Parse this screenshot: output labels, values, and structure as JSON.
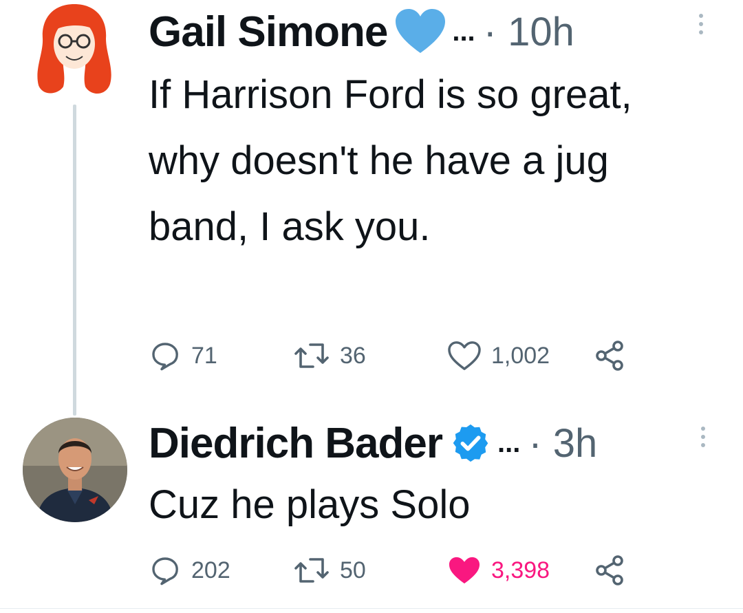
{
  "tweets": [
    {
      "author": "Gail Simone",
      "badge": "heart-badge",
      "ellipsis": "...",
      "time": "· 10h",
      "text": "If Harrison Ford is so great, why doesn't he have a jug band, I ask you.",
      "replies": "71",
      "retweets": "36",
      "likes": "1,002",
      "liked": false
    },
    {
      "author": "Diedrich Bader",
      "badge": "verified-badge",
      "ellipsis": "...",
      "time": "· 3h",
      "text": "Cuz he plays Solo",
      "replies": "202",
      "retweets": "50",
      "likes": "3,398",
      "liked": true
    }
  ],
  "colors": {
    "text": "#0f1419",
    "muted": "#536471",
    "like_active": "#f91880",
    "verified": "#1d9bf0",
    "heart_badge": "#5aaee8",
    "thread_line": "#cfd9de"
  }
}
